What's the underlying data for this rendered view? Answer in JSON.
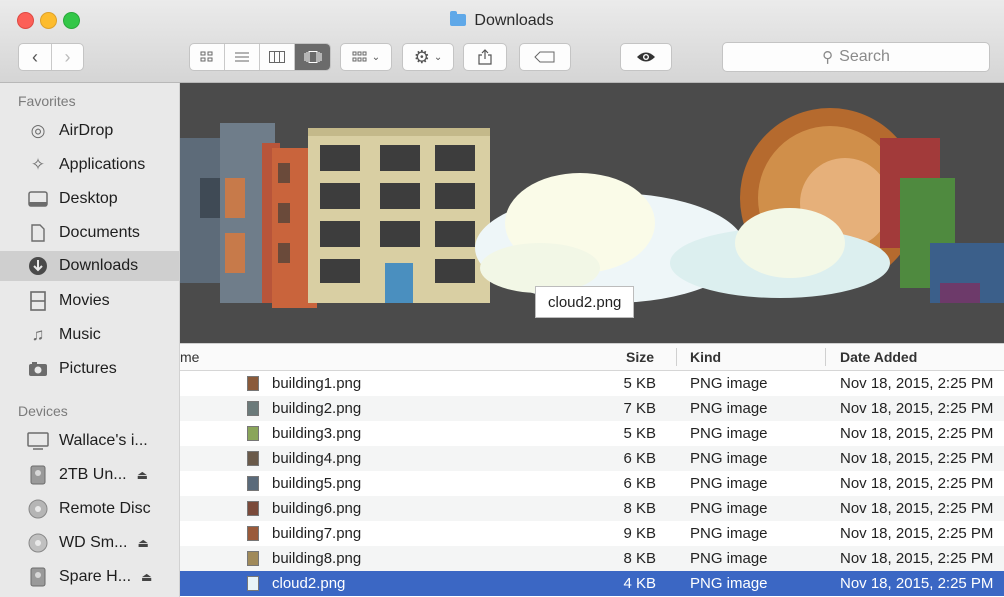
{
  "window": {
    "title": "Downloads"
  },
  "toolbar": {
    "search_placeholder": "Search"
  },
  "sidebar": {
    "favorites_heading": "Favorites",
    "favorites": [
      {
        "label": "AirDrop",
        "icon": "airdrop-icon"
      },
      {
        "label": "Applications",
        "icon": "applications-icon"
      },
      {
        "label": "Desktop",
        "icon": "desktop-icon"
      },
      {
        "label": "Documents",
        "icon": "documents-icon"
      },
      {
        "label": "Downloads",
        "icon": "downloads-icon",
        "selected": true
      },
      {
        "label": "Movies",
        "icon": "movies-icon"
      },
      {
        "label": "Music",
        "icon": "music-icon"
      },
      {
        "label": "Pictures",
        "icon": "pictures-icon"
      }
    ],
    "devices_heading": "Devices",
    "devices": [
      {
        "label": "Wallace's i...",
        "icon": "computer-icon"
      },
      {
        "label": "2TB Un...",
        "icon": "disk-icon",
        "eject": true
      },
      {
        "label": "Remote Disc",
        "icon": "remote-disc-icon"
      },
      {
        "label": "WD Sm...",
        "icon": "disk-icon",
        "eject": true
      },
      {
        "label": "Spare H...",
        "icon": "disk-icon",
        "eject": true
      }
    ]
  },
  "preview": {
    "tooltip": "cloud2.png"
  },
  "list": {
    "columns": {
      "name": "me",
      "size": "Size",
      "kind": "Kind",
      "date": "Date Added"
    },
    "rows": [
      {
        "name": "building1.png",
        "size": "5 KB",
        "kind": "PNG image",
        "date": "Nov 18, 2015, 2:25 PM",
        "icon_color": "#8a5a3a"
      },
      {
        "name": "building2.png",
        "size": "7 KB",
        "kind": "PNG image",
        "date": "Nov 18, 2015, 2:25 PM",
        "icon_color": "#6b7a7a"
      },
      {
        "name": "building3.png",
        "size": "5 KB",
        "kind": "PNG image",
        "date": "Nov 18, 2015, 2:25 PM",
        "icon_color": "#8aa55a"
      },
      {
        "name": "building4.png",
        "size": "6 KB",
        "kind": "PNG image",
        "date": "Nov 18, 2015, 2:25 PM",
        "icon_color": "#6a5a4a"
      },
      {
        "name": "building5.png",
        "size": "6 KB",
        "kind": "PNG image",
        "date": "Nov 18, 2015, 2:25 PM",
        "icon_color": "#5a6a7a"
      },
      {
        "name": "building6.png",
        "size": "8 KB",
        "kind": "PNG image",
        "date": "Nov 18, 2015, 2:25 PM",
        "icon_color": "#7a4a3a"
      },
      {
        "name": "building7.png",
        "size": "9 KB",
        "kind": "PNG image",
        "date": "Nov 18, 2015, 2:25 PM",
        "icon_color": "#9a5a3a"
      },
      {
        "name": "building8.png",
        "size": "8 KB",
        "kind": "PNG image",
        "date": "Nov 18, 2015, 2:25 PM",
        "icon_color": "#a08a5a"
      },
      {
        "name": "cloud2.png",
        "size": "4 KB",
        "kind": "PNG image",
        "date": "Nov 18, 2015, 2:25 PM",
        "icon_color": "#e8f4f8",
        "selected": true
      }
    ]
  }
}
